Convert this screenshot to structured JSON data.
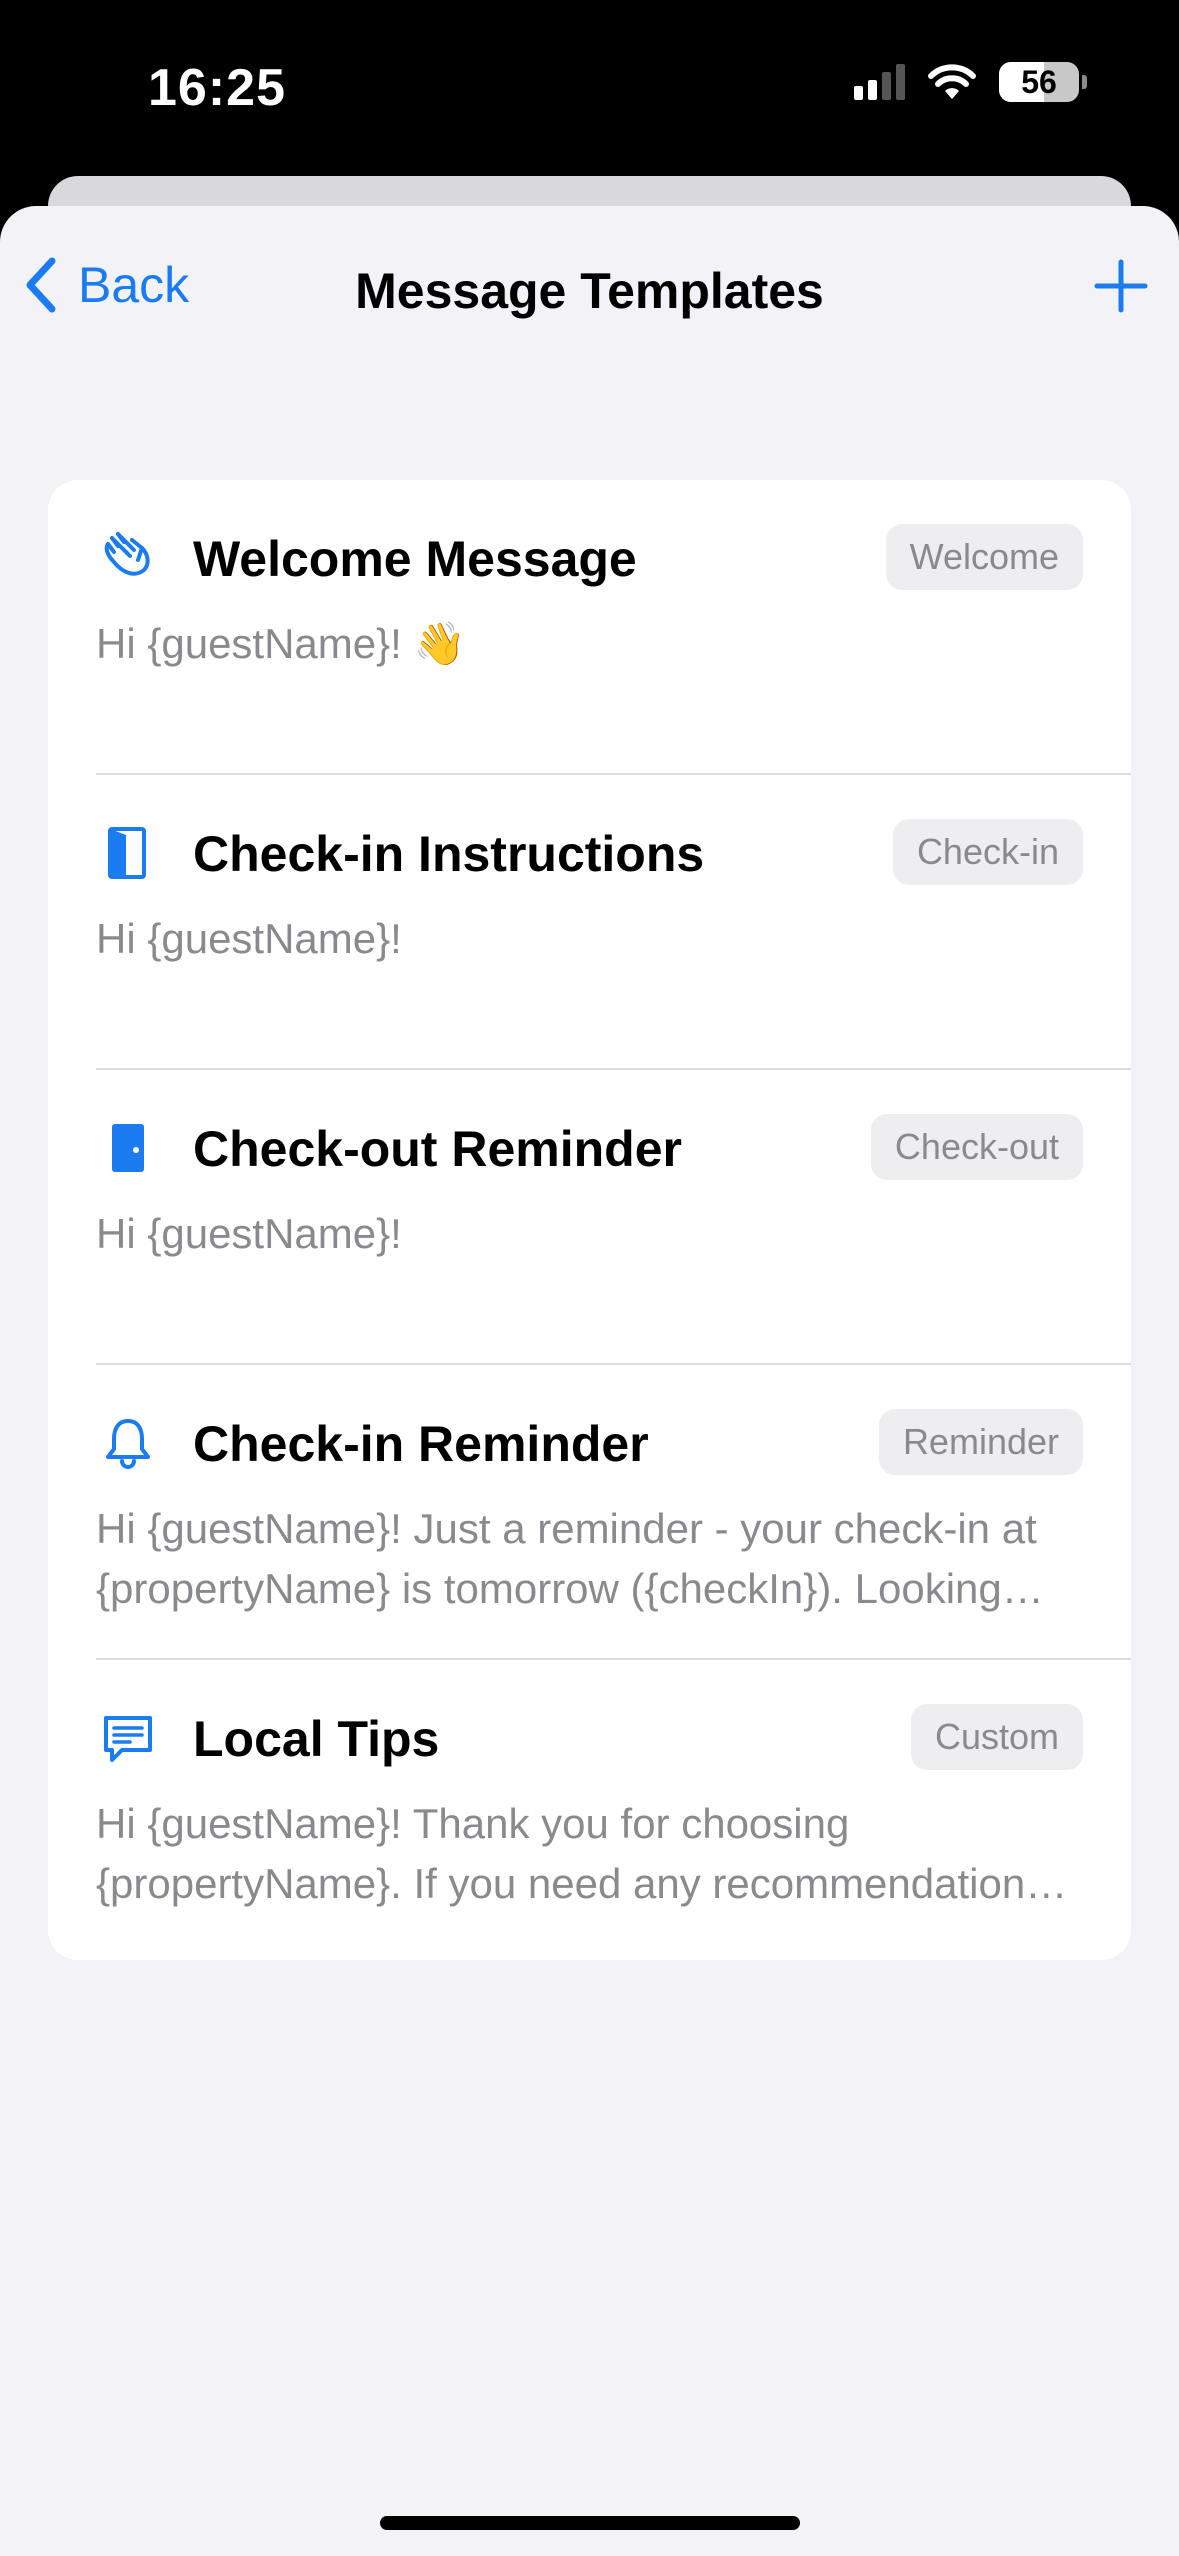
{
  "status_bar": {
    "time": "16:25",
    "battery": "56"
  },
  "nav": {
    "back_label": "Back",
    "title": "Message Templates"
  },
  "colors": {
    "accent": "#1a7cf0",
    "background": "#f2f2f7",
    "secondary_text": "#8a8a8e"
  },
  "templates": [
    {
      "icon": "waving-hand-icon",
      "title": "Welcome Message",
      "badge": "Welcome",
      "preview": "Hi {guestName}! 👋"
    },
    {
      "icon": "door-open-icon",
      "title": "Check-in Instructions",
      "badge": "Check-in",
      "preview": "Hi {guestName}!"
    },
    {
      "icon": "door-closed-icon",
      "title": "Check-out Reminder",
      "badge": "Check-out",
      "preview": "Hi {guestName}!"
    },
    {
      "icon": "bell-icon",
      "title": "Check-in Reminder",
      "badge": "Reminder",
      "preview": "Hi {guestName}! Just a reminder - your check-in at {propertyName} is tomorrow ({checkIn}). Looking forward to hosting you!"
    },
    {
      "icon": "message-text-icon",
      "title": "Local Tips",
      "badge": "Custom",
      "preview": "Hi {guestName}! Thank you for choosing {propertyName}. If you need any recommendations, feel free to ask!"
    }
  ]
}
